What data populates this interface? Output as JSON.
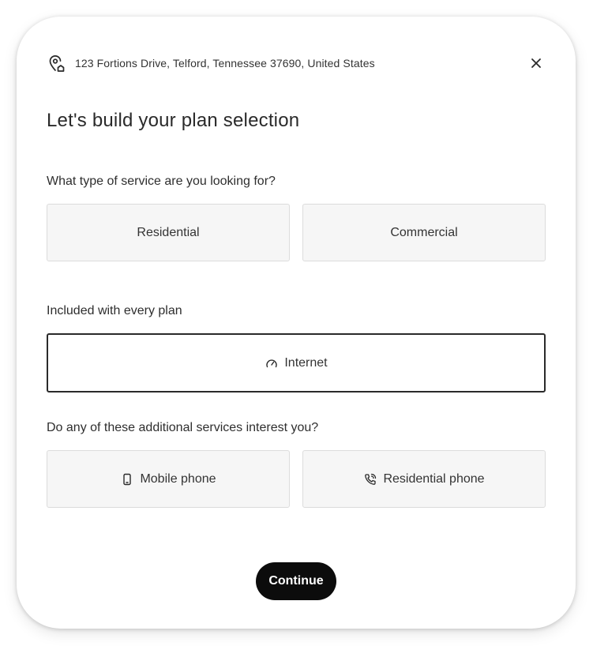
{
  "header": {
    "address": "123 Fortions Drive, Telford, Tennessee 37690, United States",
    "location_icon": "map-pin-home-icon",
    "close_icon": "close-icon"
  },
  "title": "Let's build your plan selection",
  "service_type": {
    "question": "What type of service are you looking for?",
    "options": [
      {
        "label": "Residential"
      },
      {
        "label": "Commercial"
      }
    ]
  },
  "included": {
    "heading": "Included with every plan",
    "item": {
      "label": "Internet",
      "icon": "speedometer-icon"
    }
  },
  "additional": {
    "question": "Do any of these additional services interest you?",
    "options": [
      {
        "label": "Mobile phone",
        "icon": "mobile-phone-icon"
      },
      {
        "label": "Residential phone",
        "icon": "phone-call-icon"
      }
    ]
  },
  "continue_label": "Continue",
  "colors": {
    "button_bg": "#0c0c0c",
    "option_bg": "#f6f6f6",
    "option_border": "#dcdcdc",
    "selected_border": "#2a2a2a"
  }
}
